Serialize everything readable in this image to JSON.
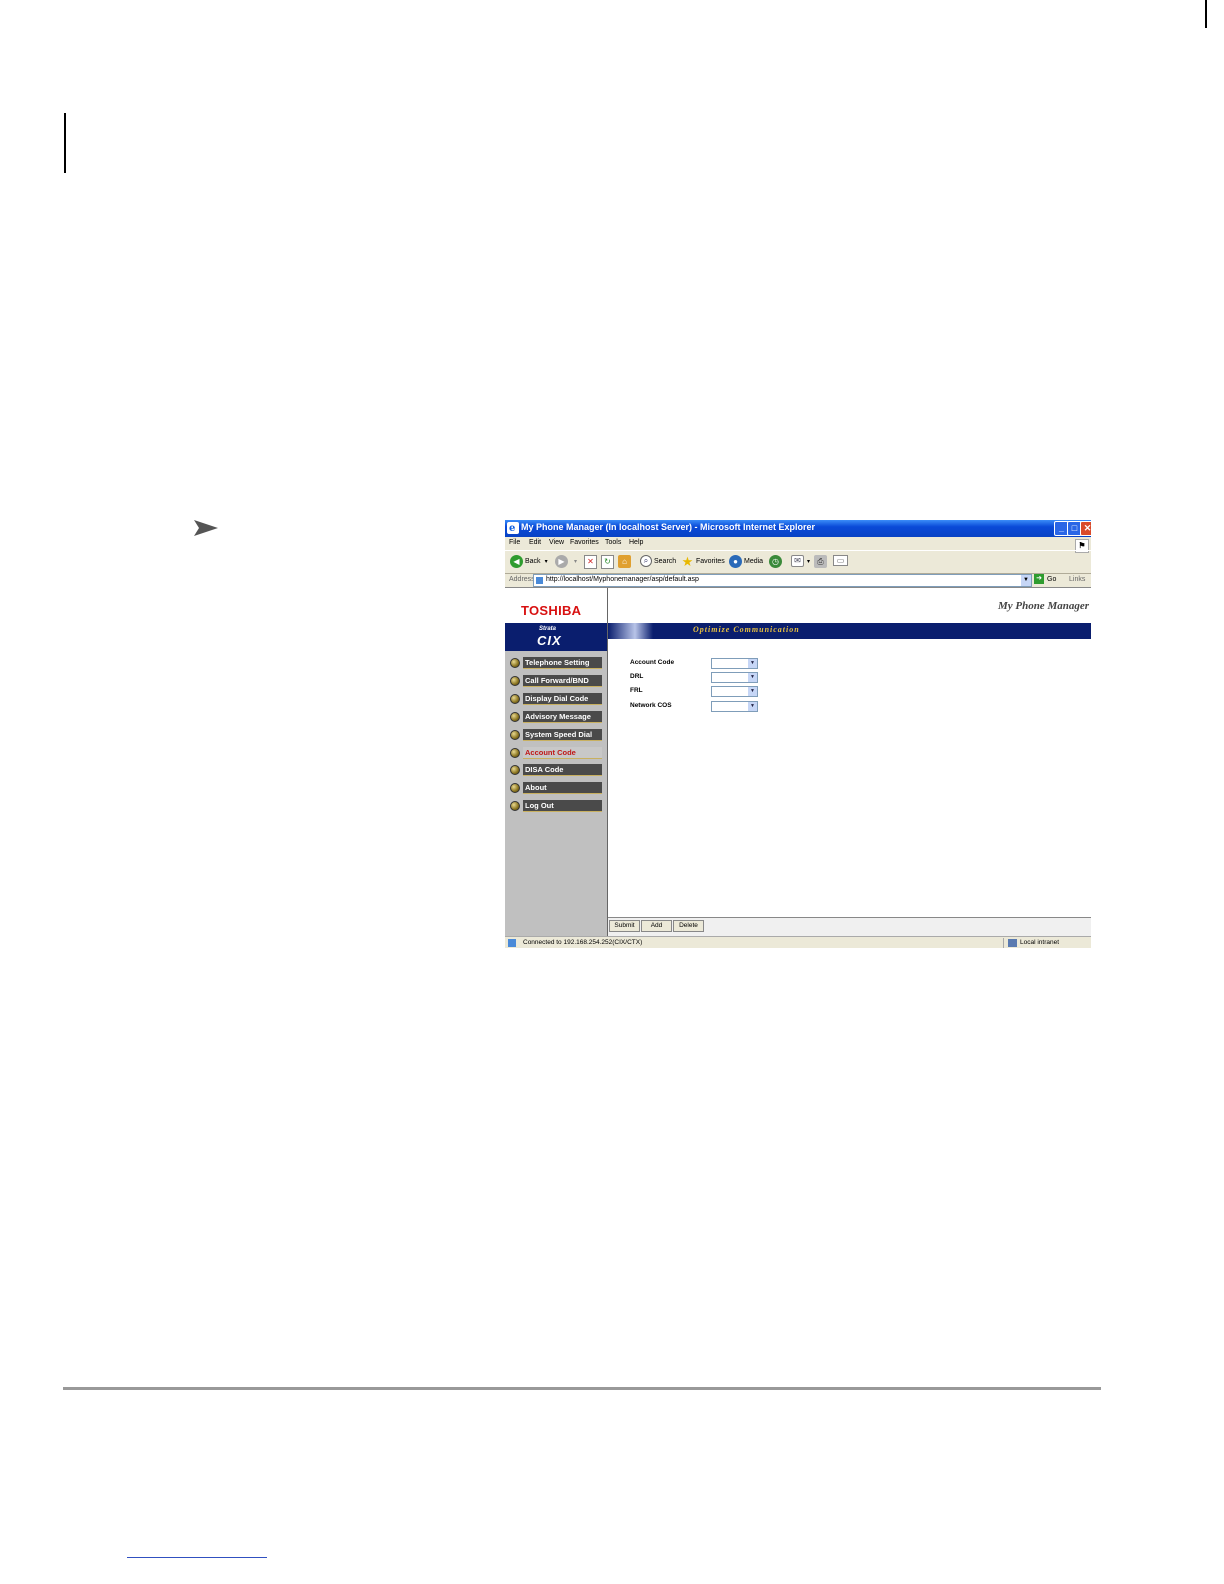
{
  "window": {
    "title": "My Phone Manager (In localhost Server) - Microsoft Internet Explorer",
    "controls": {
      "minimize": "_",
      "maximize": "□",
      "close": "✕"
    }
  },
  "menu": [
    "File",
    "Edit",
    "View",
    "Favorites",
    "Tools",
    "Help"
  ],
  "toolbar": {
    "back": "Back",
    "search": "Search",
    "favorites": "Favorites",
    "media": "Media"
  },
  "address": {
    "label": "Address",
    "url": "http://localhost/Myphonemanager/asp/default.asp",
    "go": "Go",
    "links": "Links"
  },
  "app": {
    "brand": "TOSHIBA",
    "strata": "Strata",
    "cix": "CIX",
    "title": "My Phone Manager",
    "banner": "Optimize Communication"
  },
  "nav": [
    {
      "label": "Telephone Setting",
      "active": false
    },
    {
      "label": "Call Forward/BND",
      "active": false
    },
    {
      "label": "Display Dial Code",
      "active": false
    },
    {
      "label": "Advisory Message",
      "active": false
    },
    {
      "label": "System Speed Dial",
      "active": false
    },
    {
      "label": "Account Code",
      "active": true
    },
    {
      "label": "DISA Code",
      "active": false
    },
    {
      "label": "About",
      "active": false
    },
    {
      "label": "Log Out",
      "active": false
    }
  ],
  "form": {
    "fields": [
      {
        "label": "Account Code",
        "value": ""
      },
      {
        "label": "DRL",
        "value": ""
      },
      {
        "label": "FRL",
        "value": ""
      },
      {
        "label": "Network COS",
        "value": ""
      }
    ]
  },
  "buttons": {
    "submit": "Submit",
    "add": "Add",
    "delete": "Delete"
  },
  "status": {
    "text": "Connected to 192.168.254.252(CIX/CTX)",
    "zone": "Local intranet"
  }
}
